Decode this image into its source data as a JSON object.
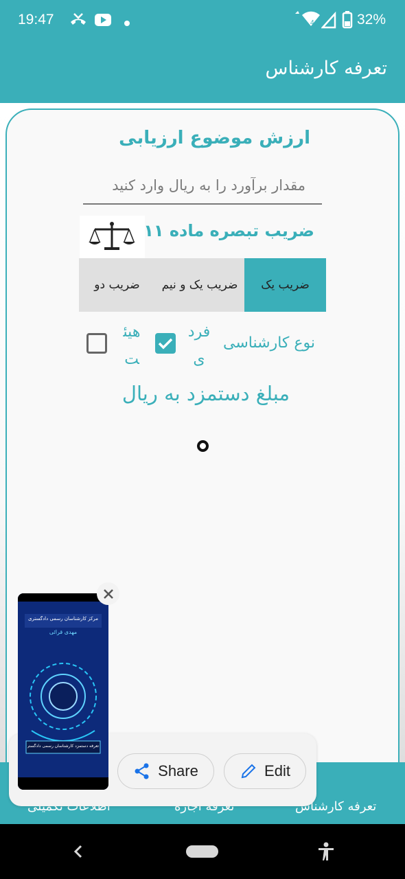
{
  "status_bar": {
    "time": "19:47",
    "battery": "32%"
  },
  "app_bar": {
    "title": "تعرفه کارشناس"
  },
  "form": {
    "section_title": "ارزش موضوع ارزیابی",
    "amount_placeholder": "مقدار برآورد را به ریال وارد کنید",
    "coef_title": "ضریب تبصره ماده ۱۱",
    "tabs": [
      {
        "label": "ضریب یک",
        "selected": true
      },
      {
        "label": "ضریب یک و نیم",
        "selected": false
      },
      {
        "label": "ضریب دو",
        "selected": false
      }
    ],
    "expert_type_label": "نوع کارشناسی",
    "options": [
      {
        "label": "فردی",
        "checked": true
      },
      {
        "label": "هیئت",
        "checked": false
      }
    ],
    "fee_label": "مبلغ دستمزد به ریال"
  },
  "bottom_nav": {
    "items": [
      "تعرفه کارشناس",
      "تعرفه اجاره",
      "اطلاعات تکمیلی"
    ]
  },
  "screenshot_sheet": {
    "share_label": "Share",
    "edit_label": "Edit",
    "thumb_title": "مرکز کارشناسان رسمی دادگستری",
    "thumb_name": "مهدی قرائی",
    "thumb_caption": "تعرفه دستمزد کارشناسان رسمی دادگستری"
  },
  "colors": {
    "accent": "#3aafb9",
    "nav_bar": "#000000"
  }
}
